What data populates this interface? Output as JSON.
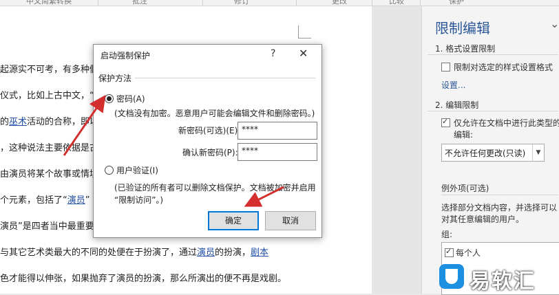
{
  "ribbon": {
    "tabs": [
      "中文简繁转换",
      "批注",
      "修订",
      "更改",
      "比较",
      "保护"
    ]
  },
  "document": {
    "lines": [
      {
        "pre": "起源实不可考，有多种假",
        "link": "",
        "post": ""
      },
      {
        "pre": "仪式，比如上古中文，“",
        "link": "",
        "post": ""
      },
      {
        "pre": "的",
        "link": "巫术",
        "post": "活动的合称，即以"
      },
      {
        "pre": "，这种说法主要依据是古",
        "link": "",
        "post": ""
      },
      {
        "pre": "由演员将某个故事或情境",
        "link": "",
        "post": ""
      },
      {
        "pre": "个元素，包括了“",
        "link": "演员",
        "post": "”"
      },
      {
        "pre": "演员”是四者当中最重要",
        "link": "",
        "post": ""
      },
      {
        "pre": "与其它艺术类最大的不同的处便在于扮演了，通过",
        "link": "演员",
        "post": "的扮演，",
        "link2": "剧本"
      },
      {
        "pre": "色才能得以伸张，如果抛弃了演员的扮演，那么所演出的便不再是戏剧。",
        "link": "",
        "post": ""
      }
    ]
  },
  "pane": {
    "title": "限制编辑",
    "close": "⌄",
    "s1_title": "1. 格式设置限制",
    "s1_check_label": "限制对选定的样式设置格式",
    "s1_settings_link": "设置...",
    "s2_title": "2. 编辑限制",
    "s2_check_label_line1": "仅允许在文档中进行此类型的",
    "s2_check_label_line2": "编辑:",
    "s2_select_value": "不允许任何更改(只读)",
    "s2_exceptions_title": "例外项(可选)",
    "s2_exceptions_desc_line1": "选择部分文档内容，并选择可以",
    "s2_exceptions_desc_line2": "对其任意编辑的用户。",
    "s2_groups_label": "组:",
    "s2_group_item": "每个人"
  },
  "dialog": {
    "title": "启动强制保护",
    "help": "?",
    "close": "✕",
    "group_label": "保护方法",
    "radio_password_label": "密码(A)",
    "password_note": "(文档没有加密。恶意用户可能会编辑文件和删除密码。)",
    "new_password_label": "新密码(可选)(E):",
    "new_password_value": "****",
    "confirm_password_label": "确认新密码(P):",
    "confirm_password_value": "****",
    "radio_user_label": "用户验证(I)",
    "user_note_line1": "(已验证的所有者可以删除文档保护。文档被加密并启用",
    "user_note_line2": "“限制访问”。)",
    "ok_label": "确定",
    "cancel_label": "取消"
  },
  "watermark": {
    "text": "易软汇"
  },
  "colors": {
    "accent": "#2b5797",
    "arrow": "#d32f2f",
    "link": "#1f4fa8"
  }
}
